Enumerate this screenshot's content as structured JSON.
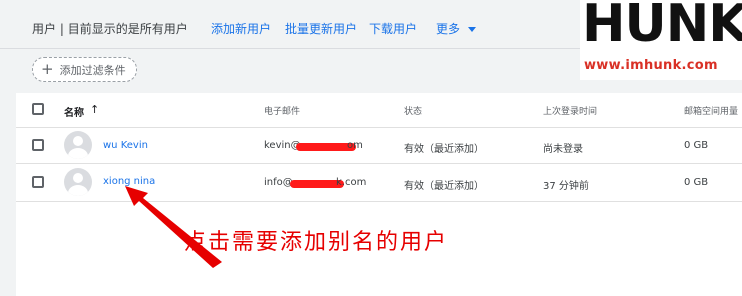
{
  "header": {
    "title": "用户",
    "subtitle": "目前显示的是所有用户",
    "actions": [
      "添加新用户",
      "批量更新用户",
      "下载用户",
      "更多"
    ]
  },
  "filter": {
    "label": "添加过滤条件"
  },
  "table": {
    "columns": [
      "名称",
      "电子邮件",
      "状态",
      "上次登录时间",
      "邮箱空间用量"
    ],
    "sort_indicator": "↑",
    "rows": [
      {
        "name": "wu Kevin",
        "email_prefix": "kevin@",
        "email_suffix": "om",
        "status": "有效（最近添加）",
        "last_login": "尚未登录",
        "storage": "0 GB"
      },
      {
        "name": "xiong nina",
        "email_prefix": "info@",
        "email_suffix": "k.com",
        "status": "有效（最近添加）",
        "last_login": "37 分钟前",
        "storage": "0 GB"
      }
    ]
  },
  "watermark": {
    "logo": "HUNK",
    "url": "www.imhunk.com"
  },
  "annotation": {
    "text": "点击需要添加别名的用户"
  },
  "colors": {
    "link": "#1a73e8",
    "annotation": "#e60000",
    "redaction": "#ff1a1a",
    "background": "#f1f3f4"
  },
  "icons": {
    "add_filter": "plus-icon",
    "more_menu": "caret-down-icon",
    "avatar": "default-avatar-icon",
    "sort": "arrow-up-icon"
  }
}
